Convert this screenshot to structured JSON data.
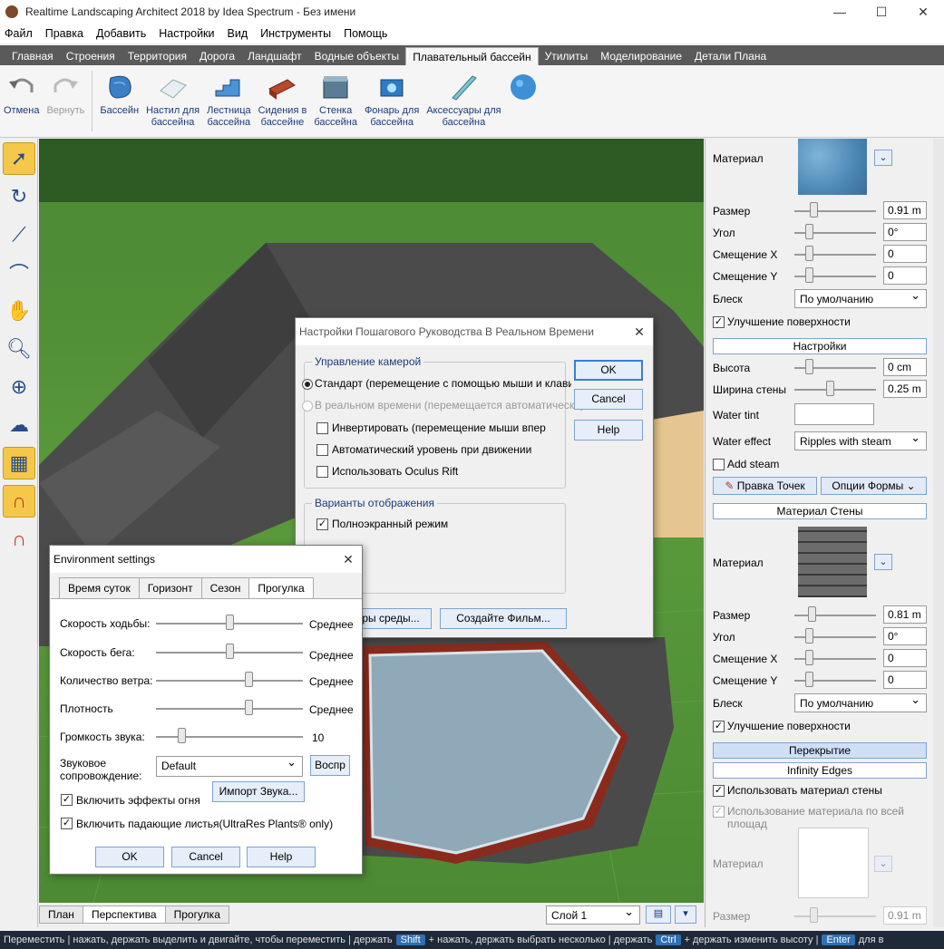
{
  "window": {
    "title": "Realtime Landscaping Architect 2018 by Idea Spectrum - Без имени",
    "minimize": "—",
    "maximize": "☐",
    "close": "✕"
  },
  "menu": [
    "Файл",
    "Правка",
    "Добавить",
    "Настройки",
    "Вид",
    "Инструменты",
    "Помощь"
  ],
  "ribbon_tabs": [
    {
      "label": "Главная"
    },
    {
      "label": "Строения"
    },
    {
      "label": "Территория"
    },
    {
      "label": "Дорога"
    },
    {
      "label": "Ландшафт"
    },
    {
      "label": "Водные объекты"
    },
    {
      "label": "Плавательный бассейн",
      "active": true
    },
    {
      "label": "Утилиты"
    },
    {
      "label": "Моделирование"
    },
    {
      "label": "Детали Плана"
    }
  ],
  "toolbar": {
    "undo": "Отмена",
    "redo": "Вернуть",
    "pool": "Бассейн",
    "deck_1": "Настил для",
    "deck_2": "бассейна",
    "stairs_1": "Лестница",
    "stairs_2": "бассейна",
    "seat_1": "Сидения в",
    "seat_2": "бассейне",
    "wall_1": "Стенка",
    "wall_2": "бассейна",
    "light_1": "Фонарь для",
    "light_2": "бассейна",
    "acc_1": "Аксессуары для",
    "acc_2": "бассейна"
  },
  "left_tools": [
    "select-arrow",
    "rotate",
    "line-edit",
    "curve",
    "pan-hand",
    "zoom",
    "zoom-window",
    "orbit",
    "grid-snap",
    "magnet-snap",
    "magnet-settings"
  ],
  "view_tabs": [
    {
      "label": "План"
    },
    {
      "label": "Перспектива",
      "active": true
    },
    {
      "label": "Прогулка"
    }
  ],
  "layer": {
    "value": "Слой 1"
  },
  "status": {
    "s1": "Переместить",
    "s2": "нажать, держать",
    "s3": "выделить и двигайте, чтобы переместить",
    "s4": "держать",
    "key_shift": "Shift",
    "s5": "+ нажать, держать",
    "s6": "выбрать несколько",
    "s7": "держать",
    "key_ctrl": "Ctrl",
    "s8": "+ держать",
    "s9": "изменить высоту",
    "key_enter": "Enter",
    "s10": "для в"
  },
  "props": {
    "material_label": "Материал",
    "size_label": "Размер",
    "size_value": "0.91 m",
    "angle_label": "Угол",
    "angle_value": "0°",
    "offset_x_label": "Смещение X",
    "offset_x_value": "0",
    "offset_y_label": "Смещение Y",
    "offset_y_value": "0",
    "gloss_label": "Блеск",
    "gloss_value": "По умолчанию",
    "surface_label": "Улучшение поверхности",
    "settings_header": "Настройки",
    "height_label": "Высота",
    "height_value": "0 cm",
    "wall_width_label": "Ширина стены",
    "wall_width_value": "0.25 m",
    "water_tint_label": "Water tint",
    "water_effect_label": "Water effect",
    "water_effect_value": "Ripples with steam",
    "add_steam_label": "Add steam",
    "edit_points": "Правка Точек",
    "shape_options": "Опции Формы",
    "wall_material_header": "Материал Стены",
    "wall_material_label": "Материал",
    "wall_size_label": "Размер",
    "wall_size_value": "0.81 m",
    "wall_angle_label": "Угол",
    "wall_angle_value": "0°",
    "wall_offset_x_label": "Смещение X",
    "wall_offset_x_value": "0",
    "wall_offset_y_label": "Смещение Y",
    "wall_offset_y_value": "0",
    "wall_gloss_label": "Блеск",
    "wall_gloss_value": "По умолчанию",
    "wall_surface_label": "Улучшение поверхности",
    "coping_header": "Перекрытие",
    "infinity_header": "Infinity Edges",
    "use_wall_material": "Использовать материал стены",
    "use_material_all": "Использование материала по всей площад",
    "coping_material_label": "Материал",
    "coping_size_label": "Размер",
    "coping_size_value": "0.91 m"
  },
  "walkthrough_dialog": {
    "title": "Настройки Пошагового Руководства В Реальном Времени",
    "camera_group": "Управление камерой",
    "standard": "Стандарт (перемещение с помощью мыши и клавиатур",
    "realtime": "В реальном времени (перемещается автоматически)",
    "invert": "Инвертировать (перемещение мыши впер",
    "auto_level": "Автоматический уровень при движении",
    "oculus": "Использовать Oculus Rift",
    "display_group": "Варианты отображения",
    "fullscreen": "Полноэкранный режим",
    "env_button": "ры среды...",
    "movie_button": "Создайте Фильм...",
    "ok": "OK",
    "cancel": "Cancel",
    "help": "Help"
  },
  "env_dialog": {
    "title": "Environment settings",
    "tabs": [
      {
        "label": "Время суток"
      },
      {
        "label": "Горизонт"
      },
      {
        "label": "Сезон"
      },
      {
        "label": "Прогулка",
        "active": true
      }
    ],
    "walk_speed": "Скорость ходьбы:",
    "walk_speed_value": "Среднее",
    "run_speed": "Скорость бега:",
    "run_speed_value": "Среднее",
    "wind": "Количество ветра:",
    "wind_value": "Среднее",
    "density": "Плотность",
    "density_value": "Среднее",
    "volume": "Громкость звука:",
    "volume_value": "10",
    "sound_1": "Звуковое",
    "sound_2": "сопровождение:",
    "sound_value": "Default",
    "play": "Воспр",
    "import_sound": "Импорт Звука...",
    "fire_effects": "Включить эффекты огня",
    "falling_leaves": "Включить падающие листья(UltraRes Plants® only)",
    "ok": "OK",
    "cancel": "Cancel",
    "help": "Help"
  },
  "colors": {
    "ribbon_bg": "#5a5a5a",
    "accent_blue": "#3c7fc8",
    "grass": "#4c8a33",
    "roof": "#4a4a4a",
    "water": "#8fa9b8",
    "status_bg": "#1e2a3a"
  }
}
